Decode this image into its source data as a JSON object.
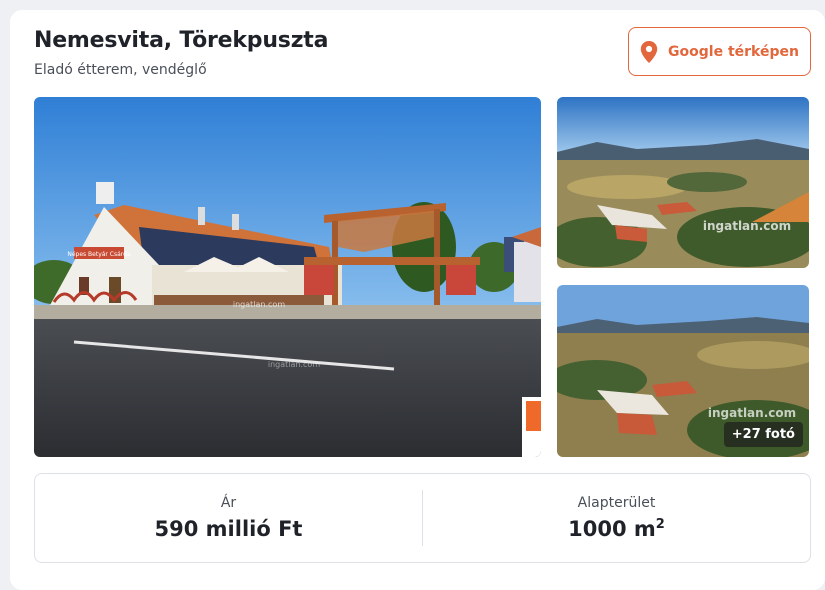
{
  "listing": {
    "title": "Nemesvita, Törekpuszta",
    "subtitle": "Eladó étterem, vendéglő",
    "map_button_label": "Google térképen"
  },
  "gallery": {
    "more_photos_label": "+27 fotó",
    "watermark": "ingatlan.com",
    "sign_text": "Népes Betyár Csárda"
  },
  "stats": {
    "price_label": "Ár",
    "price_value": "590 millió Ft",
    "area_label": "Alapterület",
    "area_value": "1000 m",
    "area_unit_sup": "2"
  },
  "colors": {
    "accent": "#e2673d",
    "text": "#1f2329",
    "muted": "#4a5059",
    "border": "#dde0e5"
  },
  "icons": {
    "map_pin": "map-pin-icon"
  }
}
